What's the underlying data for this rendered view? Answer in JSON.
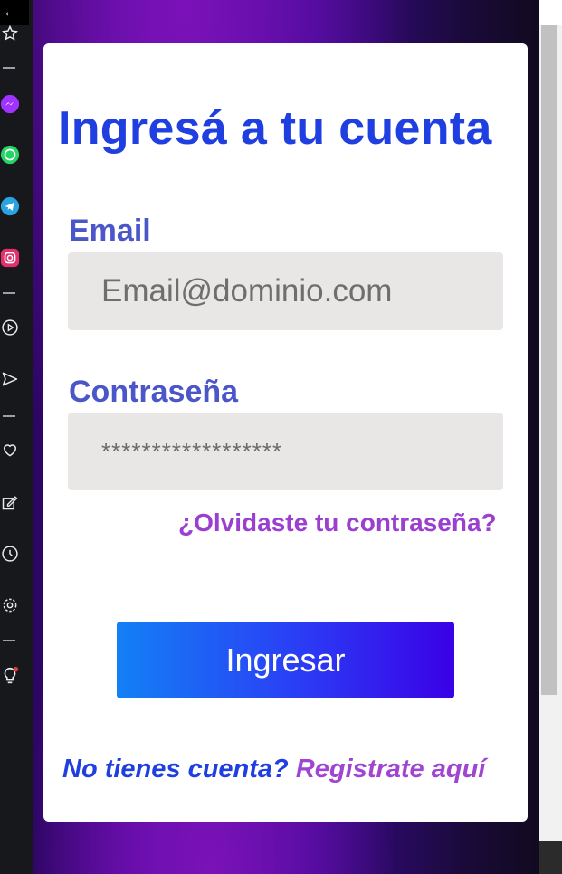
{
  "sidebar": {
    "back_icon": "arrow-left-icon",
    "items": [
      {
        "icon": "star-icon"
      },
      {
        "icon": "messenger-icon",
        "color": "#a033ff"
      },
      {
        "icon": "whatsapp-icon",
        "color": "#25d366"
      },
      {
        "icon": "telegram-icon",
        "color": "#2aa3e0"
      },
      {
        "icon": "instagram-icon",
        "color": "#e1306c"
      },
      {
        "icon": "play-icon"
      },
      {
        "icon": "send-icon"
      },
      {
        "icon": "heart-icon"
      },
      {
        "icon": "edit-icon"
      },
      {
        "icon": "clock-icon"
      },
      {
        "icon": "gear-icon"
      },
      {
        "icon": "lightbulb-icon"
      }
    ]
  },
  "form": {
    "title": "Ingresá a tu cuenta",
    "email_label": "Email",
    "email_placeholder": "Email@dominio.com",
    "password_label": "Contraseña",
    "password_value": "******************",
    "forgot_link": "¿Olvidaste tu contraseña?",
    "submit_label": "Ingresar",
    "signup_prompt": "No tienes cuenta?",
    "signup_link": "Registrate aquí"
  },
  "colors": {
    "title": "#1f3fe0",
    "label": "#4b57c9",
    "link": "#9a3fd0",
    "button_start": "#1380f5",
    "button_end": "#3a00e6"
  }
}
